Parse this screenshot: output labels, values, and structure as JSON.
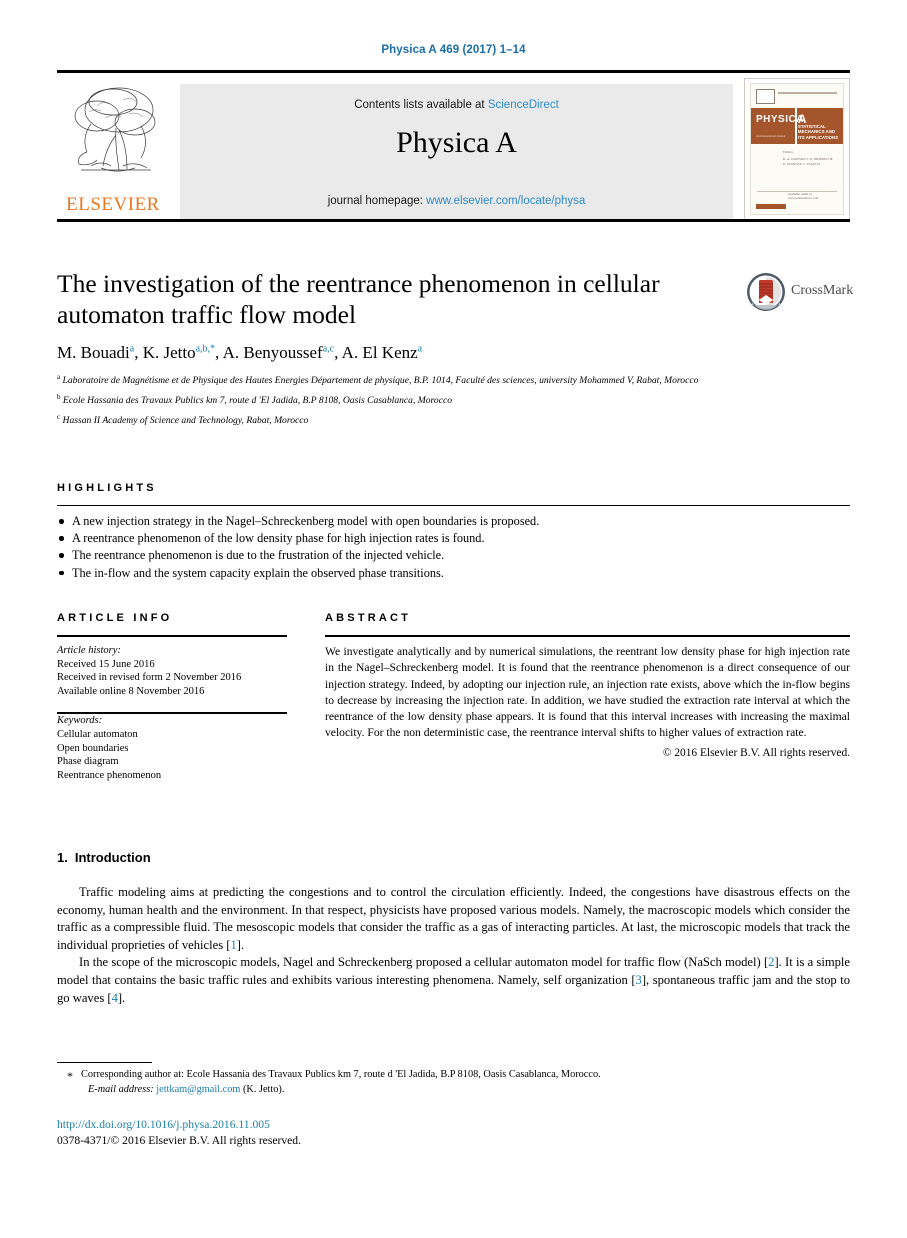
{
  "running_head": "Physica A 469 (2017) 1–14",
  "masthead": {
    "contents_prefix": "Contents lists available at ",
    "contents_link": "ScienceDirect",
    "journal_title": "Physica A",
    "homepage_prefix": "journal homepage: ",
    "homepage_link": "www.elsevier.com/locate/physa",
    "publisher_wordmark": "ELSEVIER",
    "publisher_logo_icon": "elsevier-tree-icon",
    "cover": {
      "band_title": "PHYSICA",
      "band_letter": "A",
      "band_subtitle": "STATISTICAL MECHANICS AND ITS APPLICATIONS",
      "band_color": "#a4552b",
      "editors_line": "Editors",
      "editors": "K. A. DAWSON  J. O. INDEKEU  H. E. STANLEY  C. TSALLIS",
      "footer_left": "An International Journal",
      "footer_right": "Available online at www.sciencedirect.com"
    }
  },
  "article": {
    "title": "The investigation of the reentrance phenomenon in cellular automaton traffic flow model",
    "authors": [
      {
        "name": "M. Bouadi",
        "marks": "a"
      },
      {
        "name": "K. Jetto",
        "marks": "a,b,*"
      },
      {
        "name": "A. Benyoussef",
        "marks": "a,c"
      },
      {
        "name": "A. El Kenz",
        "marks": "a"
      }
    ],
    "affiliations": [
      {
        "mark": "a",
        "text": "Laboratoire de Magnétisme et de Physique des Hautes Energies Département de physique, B.P. 1014, Faculté des sciences, university Mohammed V, Rabat, Morocco"
      },
      {
        "mark": "b",
        "text": "Ecole Hassania des Travaux Publics km 7, route d 'El Jadida, B.P 8108, Oasis Casablanca, Morocco"
      },
      {
        "mark": "c",
        "text": "Hassan II Academy of Science and Technology, Rabat, Morocco"
      }
    ],
    "crossmark_label": "CrossMark",
    "crossmark_icon": "crossmark-badge-icon"
  },
  "highlights": {
    "heading": "HIGHLIGHTS",
    "items": [
      "A new injection strategy in the Nagel–Schreckenberg model with open boundaries is proposed.",
      "A reentrance phenomenon of the low density phase for high injection rates is found.",
      "The reentrance phenomenon is due to the frustration of the injected vehicle.",
      "The in-flow and the system capacity explain the observed phase transitions."
    ]
  },
  "article_info": {
    "heading": "ARTICLE INFO",
    "history_label": "Article history:",
    "history": [
      "Received 15 June 2016",
      "Received in revised form 2 November 2016",
      "Available online 8 November 2016"
    ],
    "keywords_label": "Keywords:",
    "keywords": [
      "Cellular automaton",
      "Open boundaries",
      "Phase diagram",
      "Reentrance phenomenon"
    ]
  },
  "abstract": {
    "heading": "ABSTRACT",
    "text": "We investigate analytically and by numerical simulations, the reentrant low density phase for high injection rate in the Nagel–Schreckenberg model. It is found that the reentrance phenomenon is a direct consequence of our injection strategy. Indeed, by adopting our injection rule, an injection rate exists, above which the in-flow begins to decrease by increasing the injection rate. In addition, we have studied the extraction rate interval at which the reentrance of the low density phase appears. It is found that this interval increases with increasing the maximal velocity. For the non deterministic case, the reentrance interval shifts to higher values of extraction rate.",
    "copyright": "© 2016 Elsevier B.V. All rights reserved."
  },
  "body": {
    "section_number": "1.",
    "section_title": "Introduction",
    "paragraph1_a": "Traffic modeling aims at predicting the congestions and to control the circulation efficiently. Indeed, the congestions have disastrous effects on the economy, human health and the environment. In that respect, physicists have proposed various models. Namely, the macroscopic models which consider the traffic as a compressible fluid. The mesoscopic models that consider the traffic as a gas of interacting particles. At last, the microscopic models that track the individual proprieties of vehicles [",
    "paragraph1_ref": "1",
    "paragraph1_b": "].",
    "paragraph2_a": "In the scope of the microscopic models, Nagel and Schreckenberg proposed a cellular automaton model for traffic flow (NaSch model) [",
    "paragraph2_ref1": "2",
    "paragraph2_b": "]. It is a simple model that contains the basic traffic rules and exhibits various interesting phenomena. Namely, self organization [",
    "paragraph2_ref2": "3",
    "paragraph2_c": "], spontaneous traffic jam and the stop to go waves [",
    "paragraph2_ref3": "4",
    "paragraph2_d": "]."
  },
  "footnote": {
    "star": "*",
    "corresponding": "Corresponding author at: Ecole Hassania des Travaux Publics km 7, route d 'El Jadida, B.P 8108, Oasis Casablanca, Morocco.",
    "email_label": "E-mail address:",
    "email": "jettkam@gmail.com",
    "email_owner": "(K. Jetto).",
    "doi": "http://dx.doi.org/10.1016/j.physa.2016.11.005",
    "issn_line": "0378-4371/© 2016 Elsevier B.V. All rights reserved."
  },
  "colors": {
    "link": "#1a7fa8",
    "masthead_link": "#2e8bc9",
    "elsevier_orange": "#e87722",
    "panel_gray": "#eaeaea"
  }
}
